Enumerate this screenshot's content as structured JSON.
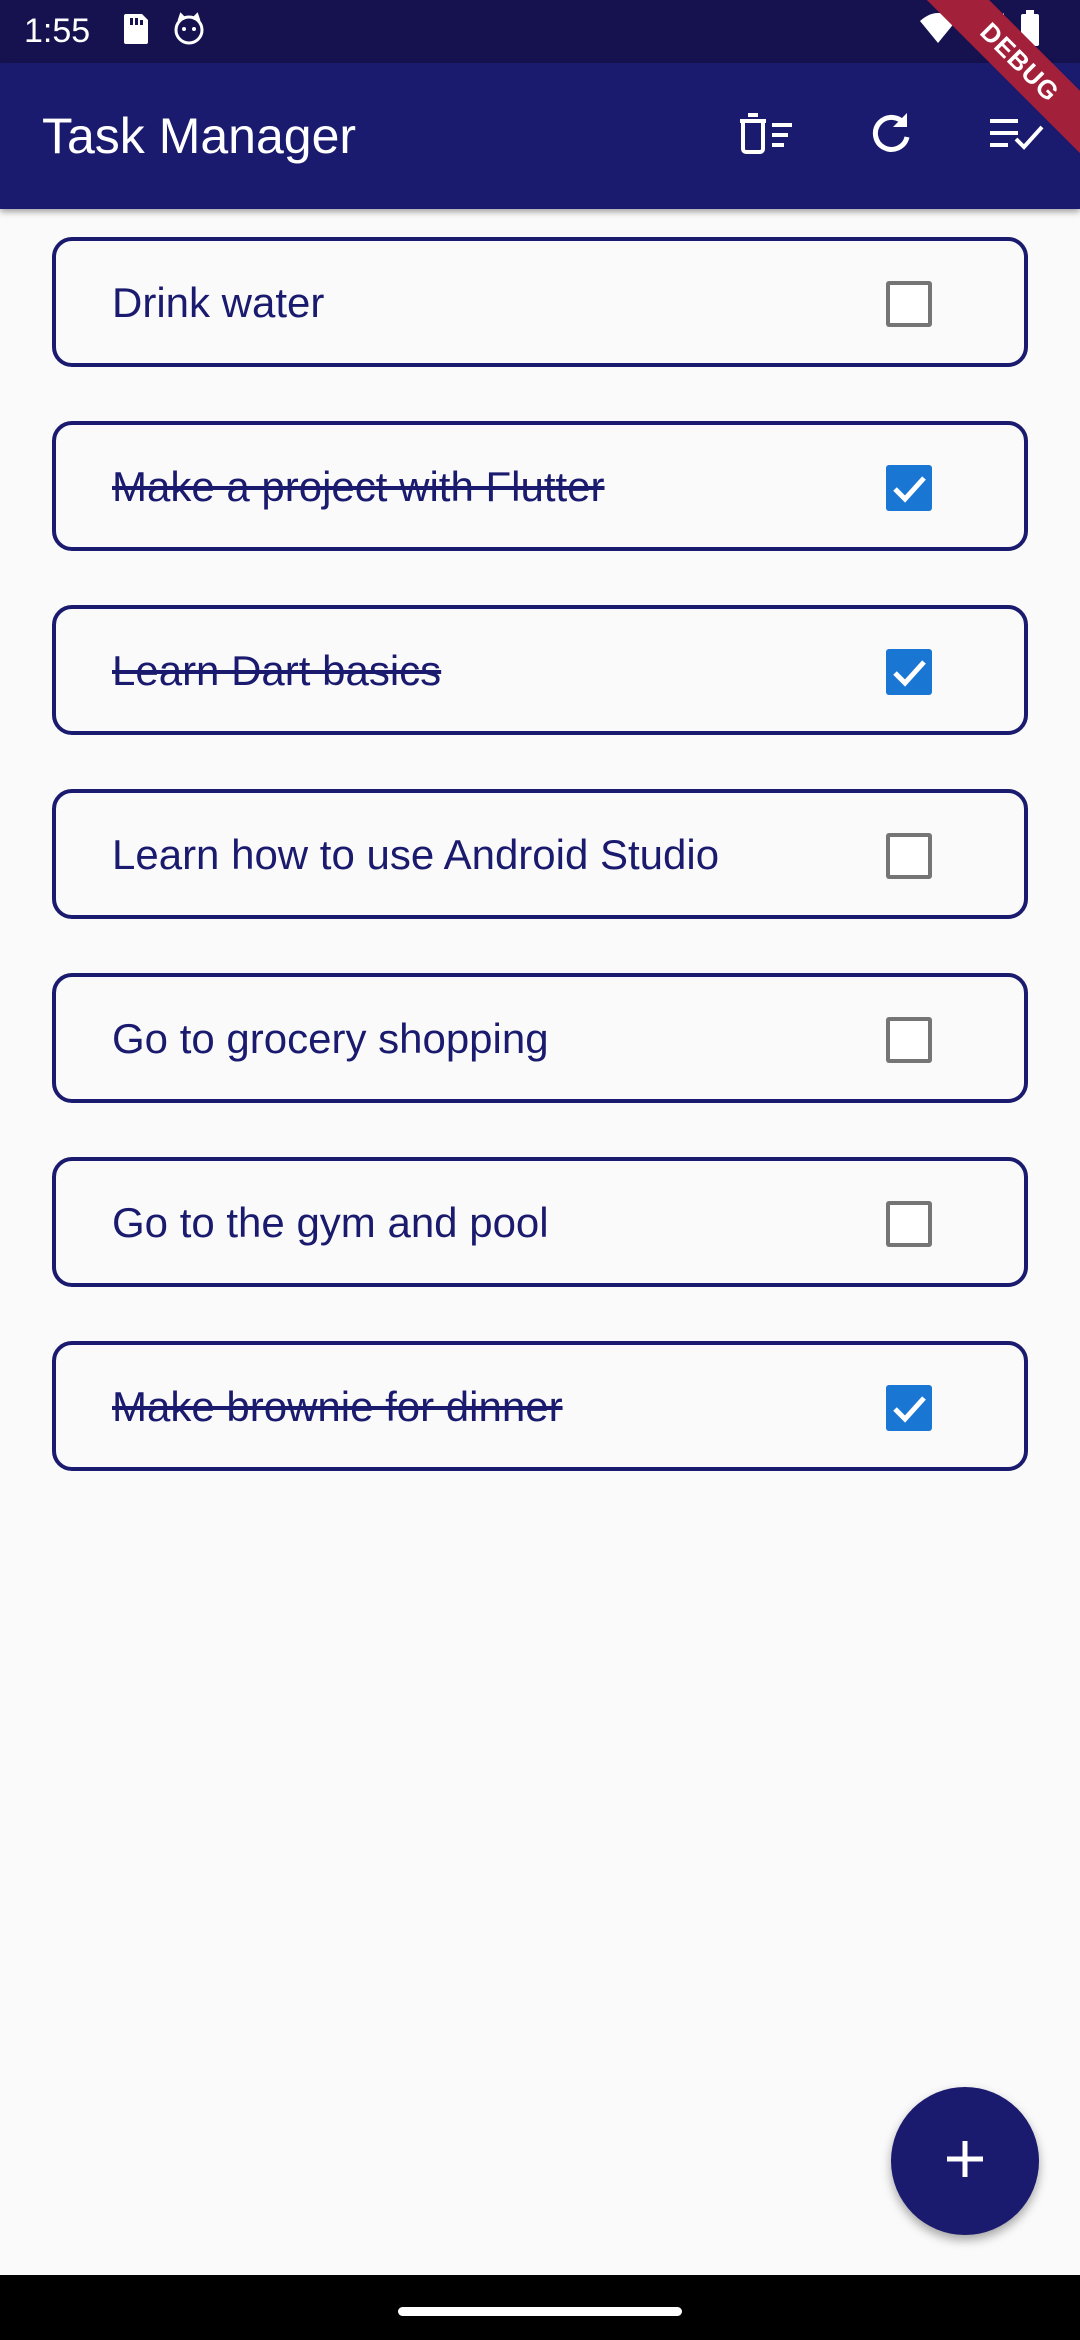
{
  "status_bar": {
    "time": "1:55",
    "icons": [
      "sd-card-icon",
      "cat-notification-icon",
      "wifi-icon",
      "signal-icon",
      "battery-icon"
    ]
  },
  "app_bar": {
    "title": "Task Manager",
    "actions": [
      "delete-completed-icon",
      "refresh-icon",
      "check-all-icon"
    ],
    "debug_banner": "DEBUG"
  },
  "colors": {
    "primary": "#1a1a6e",
    "checkbox_checked": "#1976d2",
    "background": "#fafafa",
    "debug_banner": "#a3203a"
  },
  "tasks": [
    {
      "label": "Drink water",
      "done": false
    },
    {
      "label": "Make a project with Flutter",
      "done": true
    },
    {
      "label": "Learn Dart basics",
      "done": true
    },
    {
      "label": "Learn how to use Android Studio",
      "done": false
    },
    {
      "label": "Go to grocery shopping",
      "done": false
    },
    {
      "label": "Go to the gym and pool",
      "done": false
    },
    {
      "label": "Make brownie for dinner",
      "done": true
    }
  ],
  "fab": {
    "icon": "add-icon"
  }
}
